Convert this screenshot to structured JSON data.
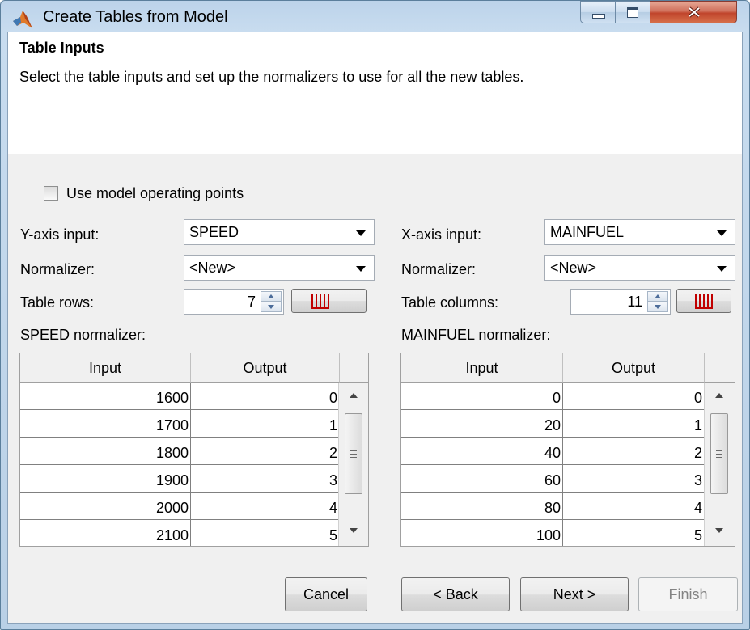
{
  "window": {
    "title": "Create Tables from Model"
  },
  "header": {
    "title": "Table Inputs",
    "description": "Select the table inputs and set up the normalizers to use for all the new tables."
  },
  "options": {
    "use_model_operating_points_label": "Use model operating points",
    "use_model_operating_points_checked": false
  },
  "y_axis": {
    "input_label": "Y-axis input:",
    "input_value": "SPEED",
    "normalizer_label": "Normalizer:",
    "normalizer_value": "<New>",
    "count_label": "Table rows:",
    "count_value": "7",
    "normalizer_table_label": "SPEED normalizer:",
    "columns": [
      "Input",
      "Output"
    ],
    "rows": [
      [
        "1600",
        "0"
      ],
      [
        "1700",
        "1"
      ],
      [
        "1800",
        "2"
      ],
      [
        "1900",
        "3"
      ],
      [
        "2000",
        "4"
      ],
      [
        "2100",
        "5"
      ]
    ]
  },
  "x_axis": {
    "input_label": "X-axis input:",
    "input_value": "MAINFUEL",
    "normalizer_label": "Normalizer:",
    "normalizer_value": "<New>",
    "count_label": "Table columns:",
    "count_value": "11",
    "normalizer_table_label": "MAINFUEL normalizer:",
    "columns": [
      "Input",
      "Output"
    ],
    "rows": [
      [
        "0",
        "0"
      ],
      [
        "20",
        "1"
      ],
      [
        "40",
        "2"
      ],
      [
        "60",
        "3"
      ],
      [
        "80",
        "4"
      ],
      [
        "100",
        "5"
      ]
    ]
  },
  "buttons": {
    "cancel": "Cancel",
    "back": "< Back",
    "next": "Next >",
    "finish": "Finish"
  }
}
